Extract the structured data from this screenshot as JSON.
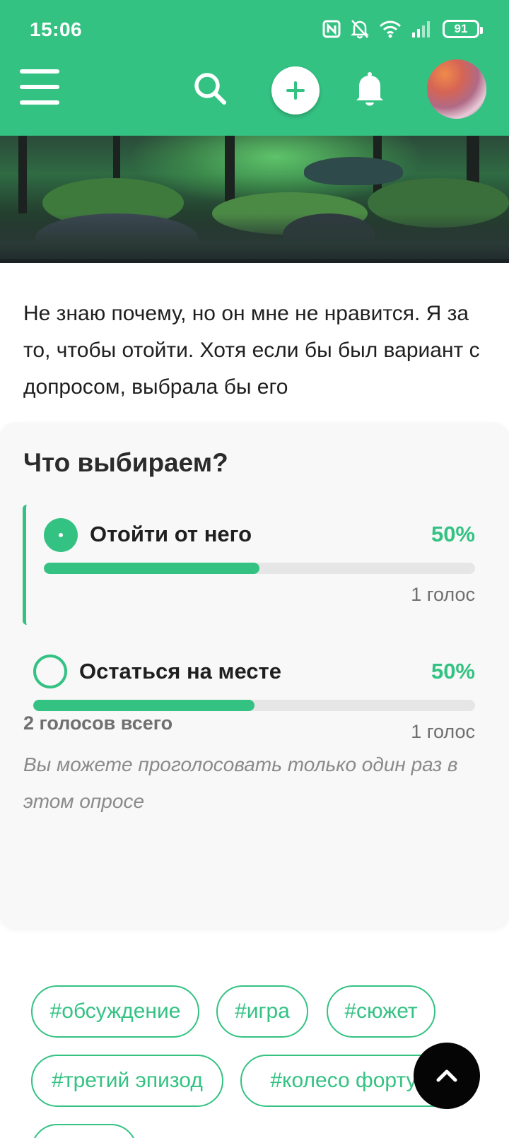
{
  "status_bar": {
    "time": "15:06",
    "battery": "91",
    "icons": [
      "nfc-icon",
      "bell-off-icon",
      "wifi-icon",
      "signal-icon",
      "battery-icon"
    ]
  },
  "app_bar": {
    "icons": [
      "menu-icon",
      "search-icon",
      "plus-icon",
      "bell-icon"
    ],
    "accent_color": "#34c283"
  },
  "post": {
    "text": "Не знаю почему, но он мне не нравится. Я за то, чтобы отойти. Хотя если бы был вариант с допросом, выбрала бы его"
  },
  "poll": {
    "title": "Что выбираем?",
    "options": [
      {
        "label": "Отойти от него",
        "percent_text": "50%",
        "percent": 50,
        "votes": "1 голос",
        "selected": true
      },
      {
        "label": "Остаться на месте",
        "percent_text": "50%",
        "percent": 50,
        "votes": "1 голос",
        "selected": false
      }
    ],
    "total": "2 голосов всего",
    "note": "Вы можете проголосовать только один раз в этом опросе"
  },
  "tags": [
    "#обсуждение",
    "#игра",
    "#сюжет",
    "#третий эпизод",
    "#колесо фортуны"
  ]
}
